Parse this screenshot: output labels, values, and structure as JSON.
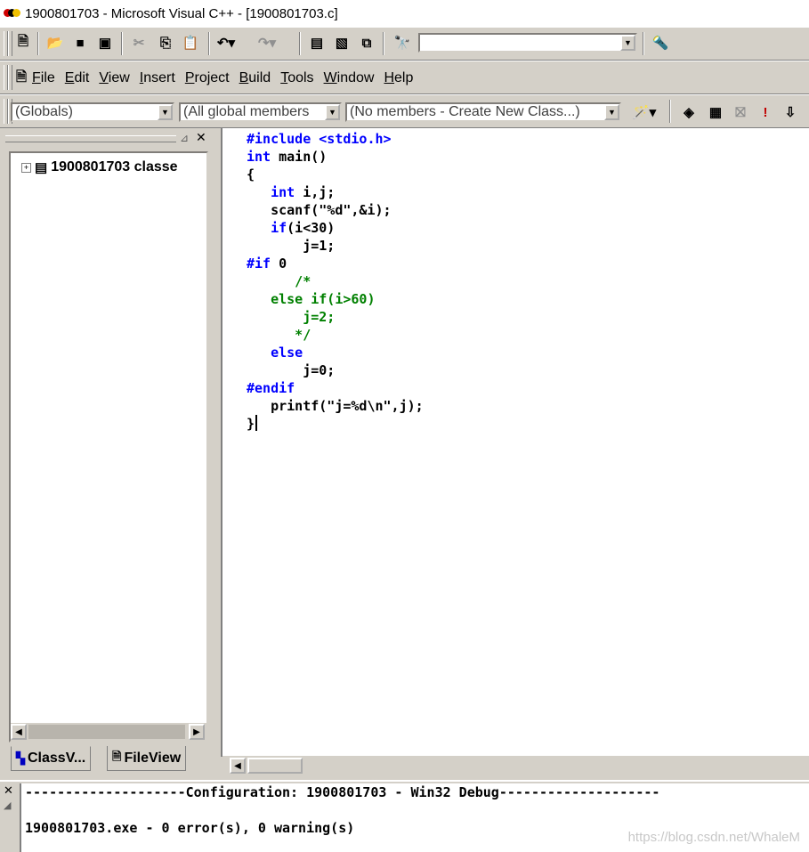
{
  "window": {
    "title": "1900801703 - Microsoft Visual C++ - [1900801703.c]"
  },
  "toolbar": {
    "find_combo_value": "",
    "icons": [
      "new-text-file-icon",
      "open-icon",
      "save-icon",
      "save-all-icon",
      "cut-icon",
      "copy-icon",
      "paste-icon",
      "undo-icon",
      "redo-icon",
      "workspace-icon",
      "output-icon",
      "window-list-icon",
      "find-in-files-icon",
      "search-combo",
      "find-icon"
    ]
  },
  "menu": {
    "items": [
      {
        "label": "File",
        "mnemonic": "F"
      },
      {
        "label": "Edit",
        "mnemonic": "E"
      },
      {
        "label": "View",
        "mnemonic": "V"
      },
      {
        "label": "Insert",
        "mnemonic": "I"
      },
      {
        "label": "Project",
        "mnemonic": "P"
      },
      {
        "label": "Build",
        "mnemonic": "B"
      },
      {
        "label": "Tools",
        "mnemonic": "T"
      },
      {
        "label": "Window",
        "mnemonic": "W"
      },
      {
        "label": "Help",
        "mnemonic": "H"
      }
    ]
  },
  "wizardbar": {
    "class_combo": "(Globals)",
    "filter_combo": "(All global members",
    "members_combo": "(No members - Create New Class...)"
  },
  "workspace": {
    "tree_root": "1900801703 classe",
    "tabs": [
      "ClassV...",
      "FileView"
    ]
  },
  "editor": {
    "lines": [
      [
        {
          "t": "#include <stdio.h>",
          "c": "kw"
        }
      ],
      [
        {
          "t": "int",
          "c": "kw"
        },
        {
          "t": " main()",
          "c": "pl"
        }
      ],
      [
        {
          "t": "{",
          "c": "pl"
        }
      ],
      [
        {
          "t": "   ",
          "c": "pl"
        },
        {
          "t": "int",
          "c": "kw"
        },
        {
          "t": " i,j;",
          "c": "pl"
        }
      ],
      [
        {
          "t": "   scanf(\"%d\",&i);",
          "c": "pl"
        }
      ],
      [
        {
          "t": "   ",
          "c": "pl"
        },
        {
          "t": "if",
          "c": "kw"
        },
        {
          "t": "(i<30)",
          "c": "pl"
        }
      ],
      [
        {
          "t": "       j=1;",
          "c": "pl"
        }
      ],
      [
        {
          "t": "#if",
          "c": "kw"
        },
        {
          "t": " 0",
          "c": "pl"
        }
      ],
      [
        {
          "t": "      /*",
          "c": "cm"
        }
      ],
      [
        {
          "t": "   else if(i>60)",
          "c": "cm"
        }
      ],
      [
        {
          "t": "       j=2;",
          "c": "cm"
        }
      ],
      [
        {
          "t": "      */",
          "c": "cm"
        }
      ],
      [
        {
          "t": "   ",
          "c": "pl"
        },
        {
          "t": "else",
          "c": "kw"
        }
      ],
      [
        {
          "t": "       j=0;",
          "c": "pl"
        }
      ],
      [
        {
          "t": "#endif",
          "c": "kw"
        }
      ],
      [
        {
          "t": "   printf(\"j=%d\\n\",j);",
          "c": "pl"
        }
      ],
      [
        {
          "t": "}",
          "c": "pl"
        }
      ]
    ]
  },
  "output": {
    "lines": [
      "--------------------Configuration: 1900801703 - Win32 Debug--------------------",
      "",
      "1900801703.exe - 0 error(s), 0 warning(s)"
    ]
  },
  "watermark": "https://blog.csdn.net/WhaleM"
}
